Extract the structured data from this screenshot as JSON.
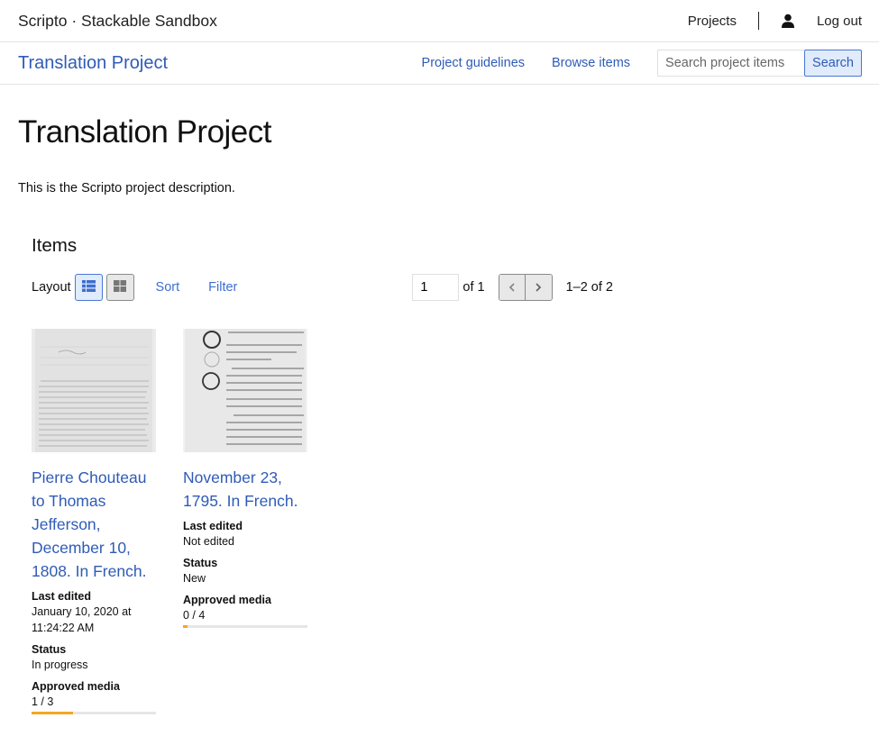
{
  "topbar": {
    "site_title": "Scripto · Stackable Sandbox",
    "projects_link": "Projects",
    "user_icon": "user-icon",
    "logout_link": "Log out"
  },
  "project_bar": {
    "title": "Translation Project",
    "guidelines_link": "Project guidelines",
    "browse_link": "Browse items",
    "search_placeholder": "Search project items",
    "search_value": "",
    "search_button": "Search"
  },
  "main": {
    "title": "Translation Project",
    "description": "This is the Scripto project description.",
    "items_heading": "Items",
    "controls": {
      "layout_label": "Layout",
      "list_icon": "list-layout-icon",
      "grid_icon": "grid-layout-icon",
      "sort_label": "Sort",
      "filter_label": "Filter",
      "page_value": "1",
      "of_pages": "of 1",
      "prev_icon": "chevron-left-icon",
      "next_icon": "chevron-right-icon",
      "range": "1–2 of 2"
    },
    "items": [
      {
        "title": "Pierre Chouteau to Thomas Jefferson, December 10, 1808. In French.",
        "last_edited_label": "Last edited",
        "last_edited": "January 10, 2020 at 11:24:22 AM",
        "status_label": "Status",
        "status": "In progress",
        "approved_label": "Approved media",
        "approved": "1 / 3",
        "approved_fraction": 0.333
      },
      {
        "title": "November 23, 1795. In French.",
        "last_edited_label": "Last edited",
        "last_edited": "Not edited",
        "status_label": "Status",
        "status": "New",
        "approved_label": "Approved media",
        "approved": "0 / 4",
        "approved_fraction": 0.0
      }
    ]
  },
  "colors": {
    "link": "#2f5bb7",
    "accent_button_bg": "#e0ebfb",
    "progress": "#f5a623"
  }
}
